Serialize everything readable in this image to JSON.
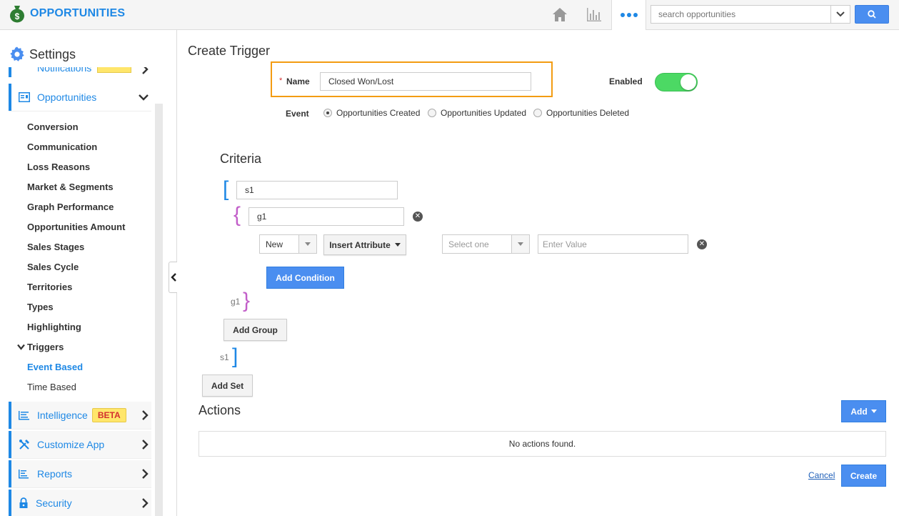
{
  "header": {
    "app_title": "OPPORTUNITIES",
    "search_placeholder": "search opportunities"
  },
  "sidebar": {
    "title": "Settings",
    "partial_item": "Notifications",
    "opportunities_label": "Opportunities",
    "sub_items": [
      "Conversion",
      "Communication",
      "Loss Reasons",
      "Market & Segments",
      "Graph Performance",
      "Opportunities Amount",
      "Sales Stages",
      "Sales Cycle",
      "Territories",
      "Types",
      "Highlighting"
    ],
    "triggers_label": "Triggers",
    "event_based": "Event Based",
    "time_based": "Time Based",
    "intelligence_label": "Intelligence",
    "beta_badge": "BETA",
    "customize_label": "Customize App",
    "reports_label": "Reports",
    "security_label": "Security"
  },
  "form": {
    "page_title": "Create Trigger",
    "required_mark": "*",
    "name_label": "Name",
    "name_value": "Closed Won/Lost",
    "enabled_label": "Enabled",
    "event_label": "Event",
    "event_options": [
      "Opportunities Created",
      "Opportunities Updated",
      "Opportunities Deleted"
    ],
    "selected_event_index": 0
  },
  "criteria": {
    "title": "Criteria",
    "set_value": "s1",
    "group_value": "g1",
    "condition_field": "New",
    "insert_attribute_label": "Insert Attribute",
    "operator_placeholder": "Select one",
    "value_placeholder": "Enter Value",
    "add_condition_label": "Add Condition",
    "group_end_label": "g1",
    "add_group_label": "Add Group",
    "set_end_label": "s1",
    "add_set_label": "Add Set"
  },
  "actions": {
    "title": "Actions",
    "add_label": "Add",
    "empty_text": "No actions found.",
    "cancel_label": "Cancel",
    "create_label": "Create"
  }
}
